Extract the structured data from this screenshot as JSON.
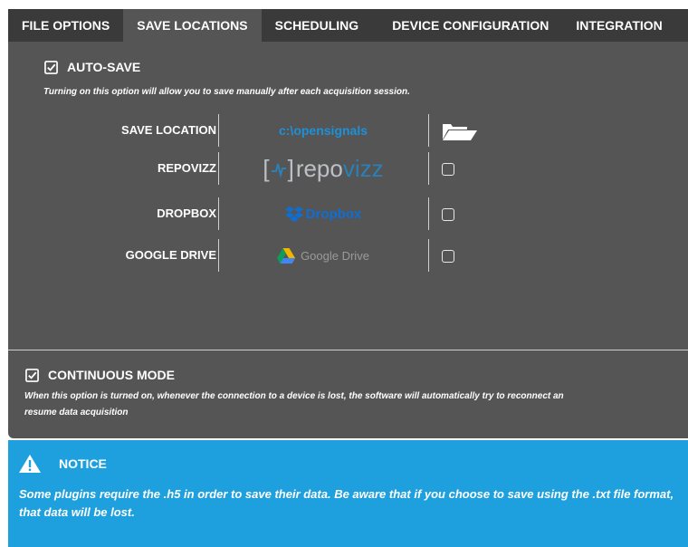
{
  "tabs": [
    {
      "label": "FILE OPTIONS"
    },
    {
      "label": "SAVE LOCATIONS"
    },
    {
      "label": "SCHEDULING"
    },
    {
      "label": "DEVICE CONFIGURATION"
    },
    {
      "label": "INTEGRATION"
    }
  ],
  "active_tab": "SAVE LOCATIONS",
  "autosave": {
    "label": "AUTO-SAVE",
    "checked": true,
    "description": "Turning on this option will allow you to save manually after each acquisition session."
  },
  "locations": {
    "save_location": {
      "label": "SAVE LOCATION",
      "value": "c:\\opensignals",
      "icon": "folder-open-icon"
    },
    "repovizz": {
      "label": "REPOVIZZ",
      "logo_left": "[",
      "logo_right": "]",
      "logo_repo": "repo",
      "logo_vizz": "vizz",
      "checked": false
    },
    "dropbox": {
      "label": "DROPBOX",
      "logo_text": "Dropbox",
      "checked": false
    },
    "google_drive": {
      "label": "GOOGLE DRIVE",
      "logo_text": "Google Drive",
      "checked": false
    }
  },
  "continuous": {
    "label": "CONTINUOUS MODE",
    "checked": true,
    "description_line1": "When this option is turned on, whenever the connection to a device is lost, the software will automatically try to reconnect an",
    "description_line2": "resume data acquisition"
  },
  "notice": {
    "title": "NOTICE",
    "icon": "warning-icon",
    "text": "Some plugins require the .h5 in order to save their data. Be aware that if you choose to save using the .txt file format, that data will be lost."
  },
  "colors": {
    "tab_bar": "#3a3a3a",
    "panel": "#555555",
    "accent_blue": "#1ea0df",
    "path_blue": "#1e90d6"
  }
}
